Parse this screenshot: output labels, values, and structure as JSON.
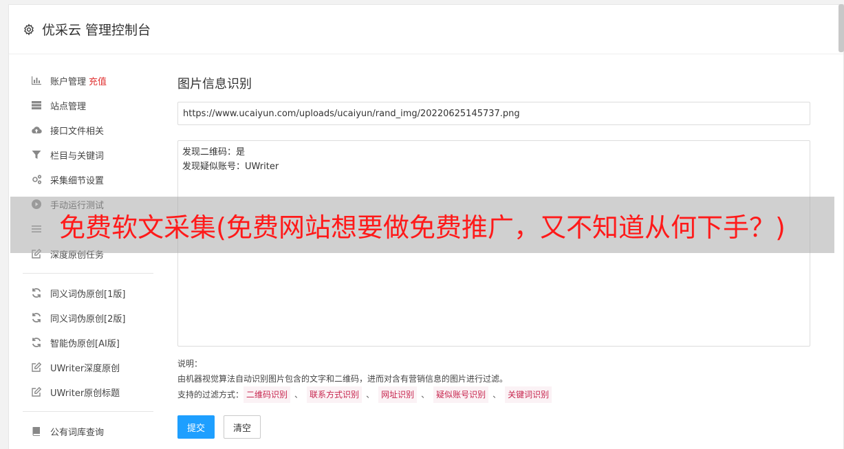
{
  "header": {
    "title": "优采云 管理控制台",
    "icon": "gear-icon"
  },
  "sidebar": {
    "group1": [
      {
        "label": "账户管理",
        "extra": "充值",
        "icon": "bar-chart-icon"
      },
      {
        "label": "站点管理",
        "icon": "server-icon"
      },
      {
        "label": "接口文件相关",
        "icon": "cloud-upload-icon"
      },
      {
        "label": "栏目与关键词",
        "icon": "filter-icon"
      },
      {
        "label": "采集细节设置",
        "icon": "gears-icon"
      },
      {
        "label": "手动运行测试",
        "icon": "play-circle-icon"
      },
      {
        "label": "",
        "icon": "list-icon"
      },
      {
        "label": "深度原创任务",
        "icon": "edit-icon"
      }
    ],
    "group2": [
      {
        "label": "同义词伪原创[1版]",
        "icon": "refresh-icon"
      },
      {
        "label": "同义词伪原创[2版]",
        "icon": "refresh-icon"
      },
      {
        "label": "智能伪原创[AI版]",
        "icon": "refresh-icon"
      },
      {
        "label": "UWriter深度原创",
        "icon": "edit-icon"
      },
      {
        "label": "UWriter原创标题",
        "icon": "edit-icon"
      }
    ],
    "group3": [
      {
        "label": "公有词库查询",
        "icon": "book-icon"
      }
    ]
  },
  "main": {
    "section_title": "图片信息识别",
    "url_value": "https://www.ucaiyun.com/uploads/ucaiyun/rand_img/20220625145737.png",
    "result_text": "发现二维码：是\n发现疑似账号：UWriter",
    "desc_heading": "说明：",
    "desc_line": "由机器视觉算法自动识别图片包含的文字和二维码，进而对含有营销信息的图片进行过滤。",
    "filter_label": "支持的过滤方式：",
    "filter_tags": [
      "二维码识别",
      "联系方式识别",
      "网址识别",
      "疑似账号识别",
      "关键词识别"
    ],
    "filter_sep": "、",
    "submit_label": "提交",
    "clear_label": "清空"
  },
  "overlay": {
    "text": "免费软文采集(免费网站想要做免费推广，又不知道从何下手？)"
  },
  "colors": {
    "primary": "#1e9fff",
    "accent_red": "#e03030",
    "tag_text": "#c7254e",
    "overlay_text": "#ff1a1a"
  }
}
